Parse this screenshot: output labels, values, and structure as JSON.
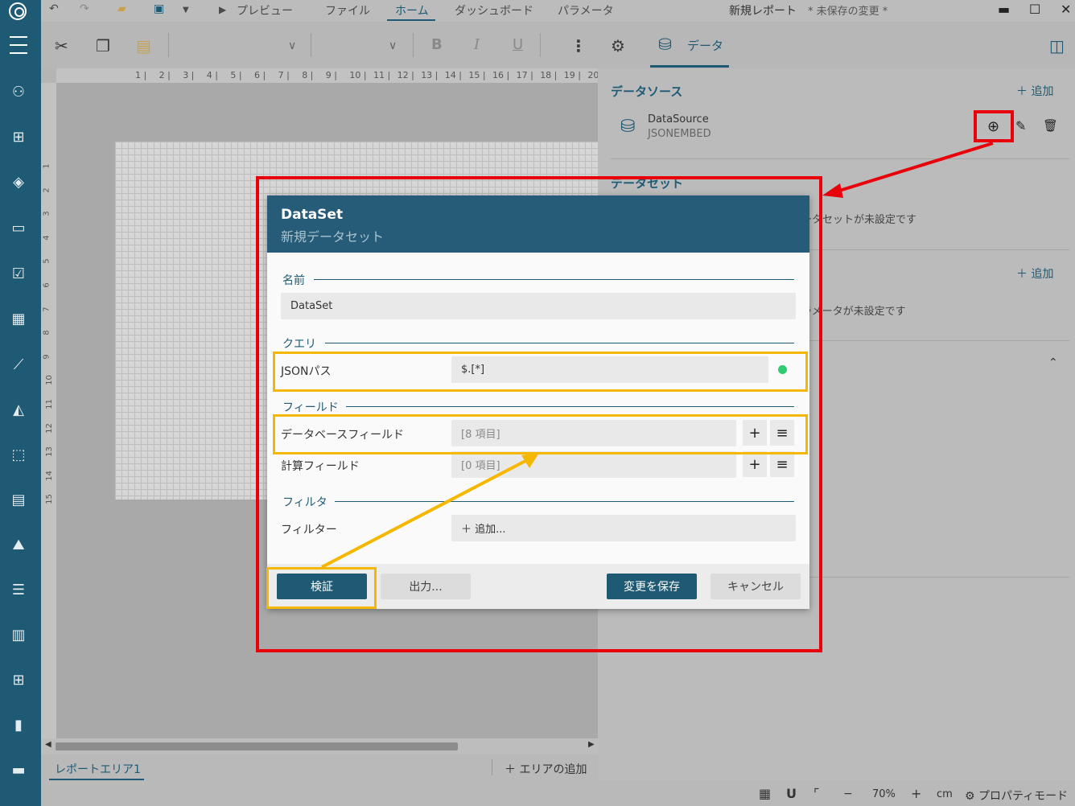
{
  "menu": {
    "preview": "プレビュー",
    "file": "ファイル",
    "home": "ホーム",
    "dashboard": "ダッシュボード",
    "parameters": "パラメータ"
  },
  "window": {
    "title": "新規レポート",
    "unsaved": "* 未保存の変更 *"
  },
  "toolbar": {
    "bold": "B",
    "italic": "I",
    "underline": "U",
    "data_tab": "データ"
  },
  "ruler": {
    "h_ticks": [
      "1",
      "2",
      "3",
      "4",
      "5",
      "6",
      "7",
      "8",
      "9",
      "10",
      "11",
      "12",
      "13",
      "14",
      "15",
      "16",
      "17",
      "18",
      "19",
      "20"
    ],
    "v_ticks": [
      "1",
      "2",
      "3",
      "4",
      "5",
      "6",
      "7",
      "8",
      "9",
      "10",
      "11",
      "12",
      "13",
      "14",
      "15"
    ]
  },
  "bottom": {
    "report_tab": "レポートエリア1",
    "add_area": "エリアの追加"
  },
  "status": {
    "zoom": "70%",
    "unit": "cm",
    "property_mode": "プロパティモード"
  },
  "right_panel": {
    "datasource_heading": "データソース",
    "add_label": "追加",
    "datasource_name": "DataSource",
    "datasource_type": "JSONEMBED",
    "dataset_heading": "データセット",
    "dataset_empty": "データセットが未設定です",
    "param_add_label": "追加",
    "param_empty": "パラメータが未設定です"
  },
  "dialog": {
    "title": "DataSet",
    "subtitle": "新規データセット",
    "section_name": "名前",
    "name_value": "DataSet",
    "section_query": "クエリ",
    "jsonpath_label": "JSONパス",
    "jsonpath_value": "$.[*]",
    "section_fields": "フィールド",
    "db_fields_label": "データベースフィールド",
    "db_fields_value": "[8 項目]",
    "calc_fields_label": "計算フィールド",
    "calc_fields_value": "[0 項目]",
    "section_filter": "フィルタ",
    "filter_label": "フィルター",
    "filter_add": "追加...",
    "validate_btn": "検証",
    "output_btn": "出力...",
    "save_btn": "変更を保存",
    "cancel_btn": "キャンセル"
  },
  "colors": {
    "accent": "#1f5a74",
    "annotation_red": "#e8000b",
    "annotation_yellow": "#f5b700",
    "status_ok": "#2ecc71"
  }
}
